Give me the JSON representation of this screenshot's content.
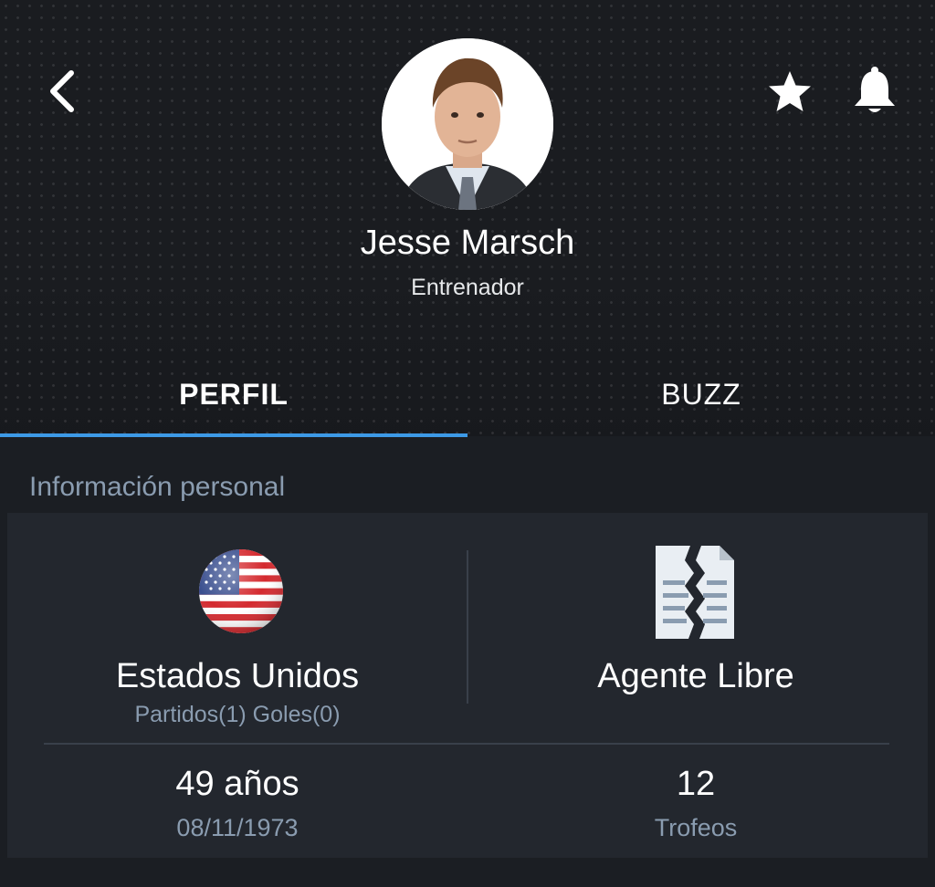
{
  "header": {
    "back_icon": "chevron-left-icon",
    "favorite_icon": "star-icon",
    "notification_icon": "bell-icon",
    "name": "Jesse Marsch",
    "role": "Entrenador"
  },
  "tabs": [
    {
      "label": "PERFIL",
      "active": true
    },
    {
      "label": "BUZZ",
      "active": false
    }
  ],
  "personal_info": {
    "section_title": "Información personal",
    "nationality": "Estados Unidos",
    "nationality_flag_icon": "us-flag-icon",
    "national_stats": "Partidos(1) Goles(0)",
    "contract_status": "Agente Libre",
    "contract_icon": "torn-contract-icon",
    "age": "49 años",
    "birth_date": "08/11/1973",
    "trophies_count": "12",
    "trophies_label": "Trofeos"
  },
  "colors": {
    "accent": "#3d9ae6",
    "background": "#1b1e23",
    "card": "#23272e",
    "muted_text": "#8a9cb0"
  }
}
